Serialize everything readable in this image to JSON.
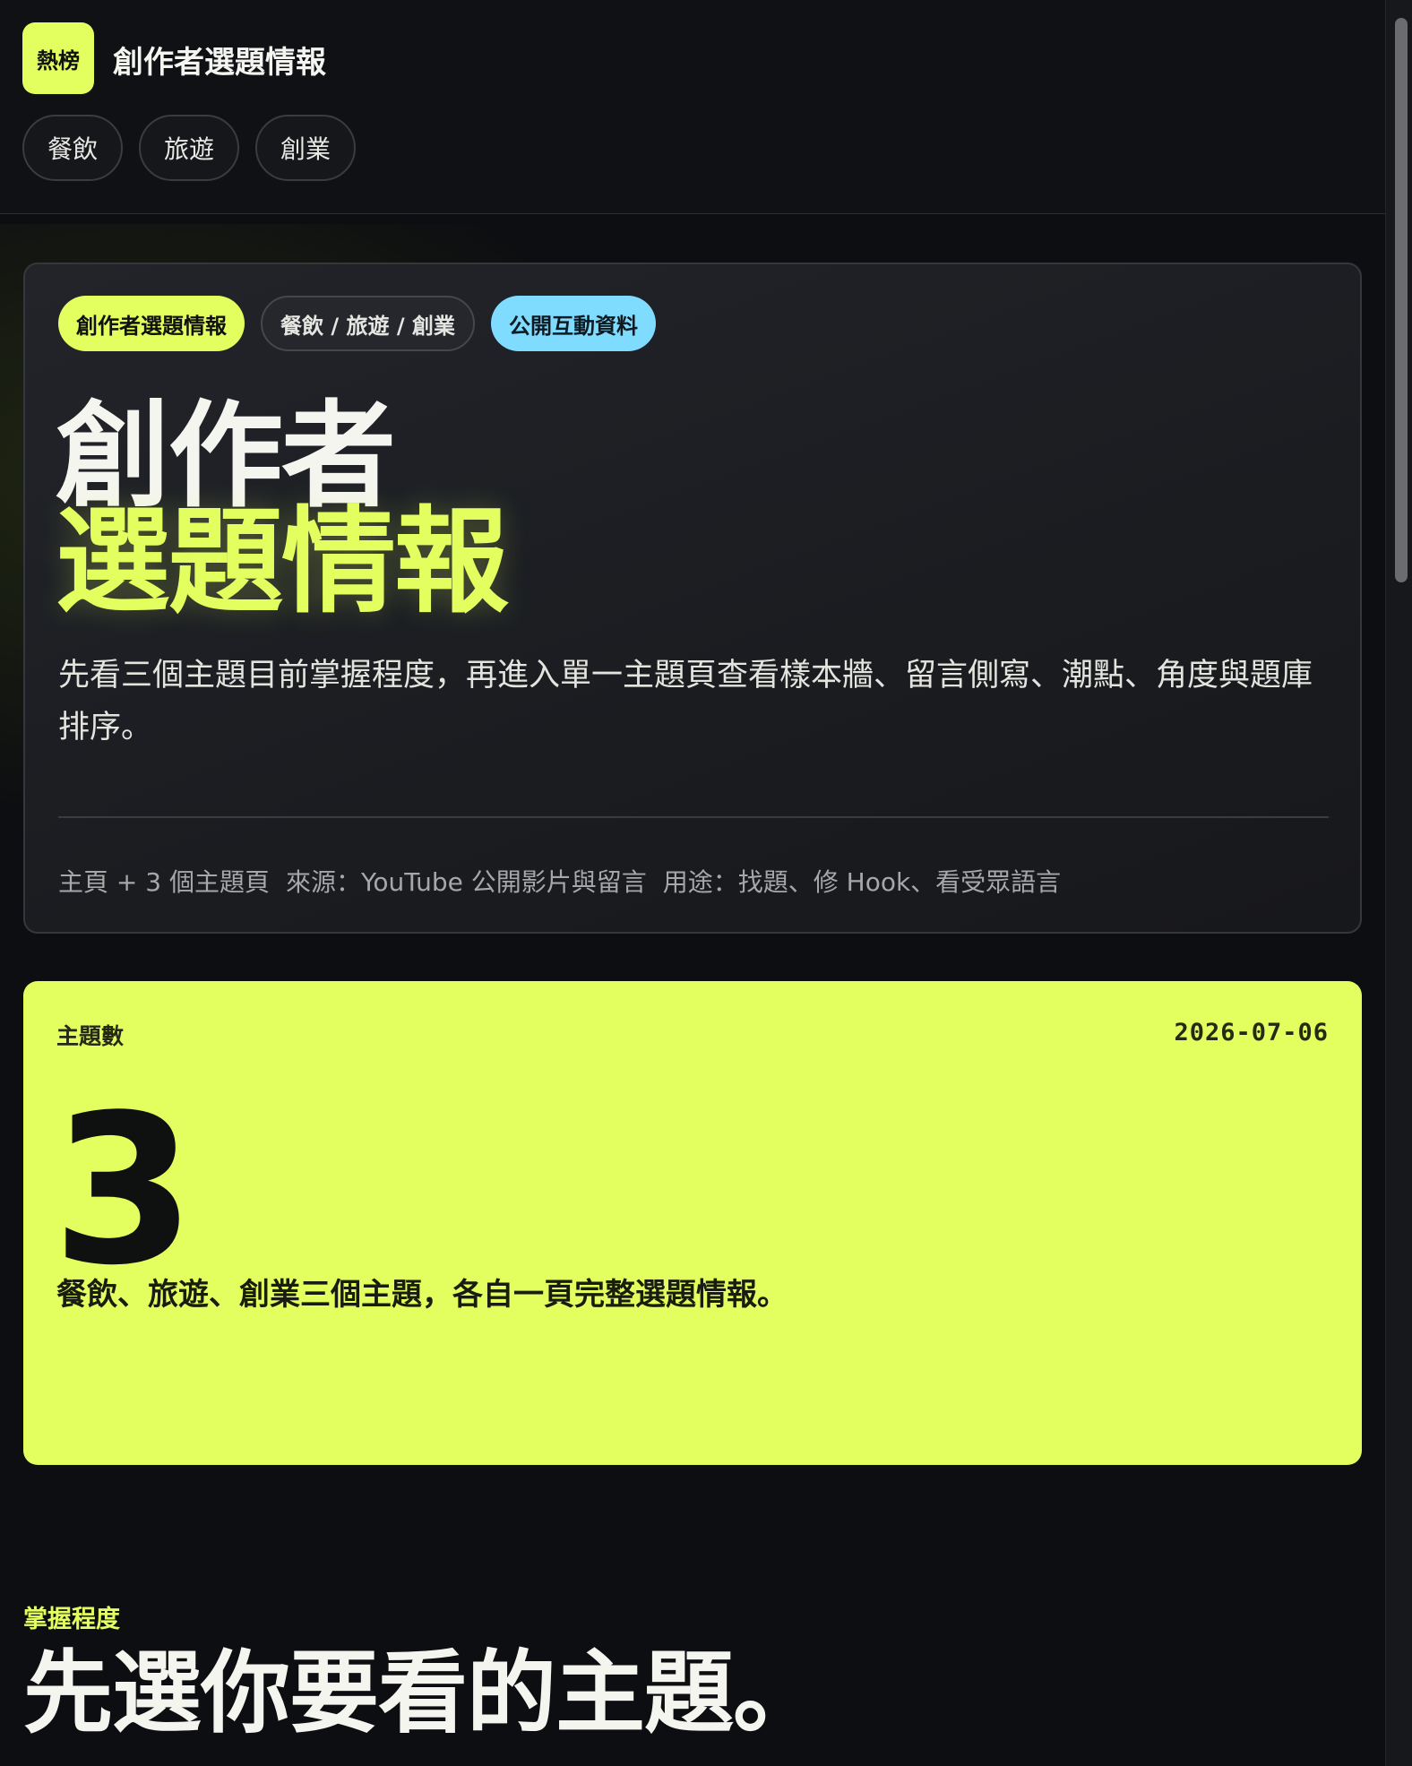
{
  "header": {
    "logo_text": "熱榜",
    "title": "創作者選題情報",
    "nav": [
      "餐飲",
      "旅遊",
      "創業"
    ]
  },
  "hero": {
    "chips": [
      "創作者選題情報",
      "餐飲 / 旅遊 / 創業",
      "公開互動資料"
    ],
    "title_line1": "創作者",
    "title_line2": "選題情報",
    "description": "先看三個主題目前掌握程度，再進入單一主題頁查看樣本牆、留言側寫、潮點、角度與題庫排序。",
    "meta": [
      "主頁 + 3 個主題頁",
      "來源：YouTube 公開影片與留言",
      "用途：找題、修 Hook、看受眾語言"
    ]
  },
  "stat": {
    "label": "主題數",
    "date": "2026-07-06",
    "value": "3",
    "description": "餐飲、旅遊、創業三個主題，各自一頁完整選題情報。"
  },
  "section": {
    "kicker": "掌握程度",
    "title": "先選你要看的主題。"
  },
  "colors": {
    "accent_lime": "#e2fe5f",
    "accent_cyan": "#7fdcff",
    "background": "#0d0e11"
  }
}
